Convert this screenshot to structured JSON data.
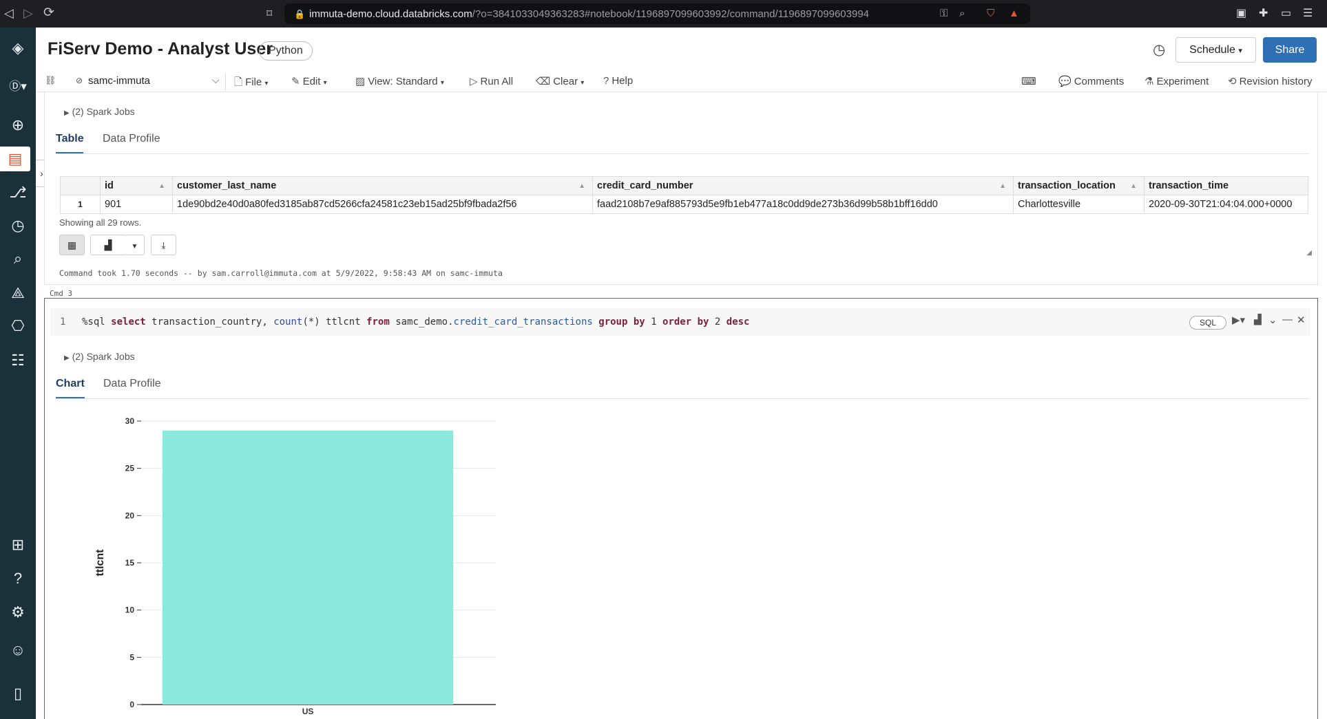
{
  "browser": {
    "url_host": "immuta-demo.cloud.databricks.com",
    "url_path": "/?o=3841033049363283#notebook/1196897099603992/command/1196897099603994"
  },
  "notebook": {
    "title": "FiServ Demo - Analyst User",
    "language": "Python",
    "schedule_label": "Schedule",
    "share_label": "Share"
  },
  "toolbar": {
    "cluster": "samc-immuta",
    "file": "File",
    "edit": "Edit",
    "view": "View: Standard",
    "run_all": "Run All",
    "clear": "Clear",
    "help": "Help",
    "comments": "Comments",
    "experiment": "Experiment",
    "revision_history": "Revision history"
  },
  "cell2": {
    "spark_jobs": "(2) Spark Jobs",
    "tabs": [
      "Table",
      "Data Profile"
    ],
    "columns": [
      "id",
      "customer_last_name",
      "credit_card_number",
      "transaction_location",
      "transaction_time"
    ],
    "rows": [
      {
        "num": "1",
        "id": "901",
        "customer_last_name": "1de90bd2e40d0a80fed3185ab87cd5266cfa24581c23eb15ad25bf9fbada2f56",
        "credit_card_number": "faad2108b7e9af885793d5e9fb1eb477a18c0dd9de273b36d99b58b1bff16dd0",
        "transaction_location": "Charlottesville",
        "transaction_time": "2020-09-30T21:04:04.000+0000"
      }
    ],
    "row_count": "Showing all 29 rows.",
    "command_took": "Command took 1.70 seconds -- by sam.carroll@immuta.com at 5/9/2022, 9:58:43 AM on samc-immuta"
  },
  "cell3": {
    "label": "Cmd 3",
    "line_number": "1",
    "code": {
      "magic": "%sql",
      "kw_select": "select",
      "col1": "transaction_country,",
      "fn_count": "count",
      "fn_args": "(*) ttlcnt",
      "kw_from": "from",
      "schema": "samc_demo.",
      "table": "credit_card_transactions",
      "kw_group": "group by",
      "n1": "1",
      "kw_order": "order by",
      "n2": "2",
      "kw_desc": "desc"
    },
    "lang_badge": "SQL",
    "spark_jobs": "(2) Spark Jobs",
    "tabs": [
      "Chart",
      "Data Profile"
    ]
  },
  "chart_data": {
    "type": "bar",
    "categories": [
      "US"
    ],
    "values": [
      29
    ],
    "xlabel": "",
    "ylabel": "ttlcnt",
    "ylim": [
      0,
      30
    ],
    "yticks": [
      0,
      5,
      10,
      15,
      20,
      25,
      30
    ],
    "grid": true,
    "bar_color": "#8ae9dc"
  },
  "colors": {
    "rail": "#1b3139",
    "share": "#2f6fb5",
    "active_rail_icon": "#e0532f"
  }
}
